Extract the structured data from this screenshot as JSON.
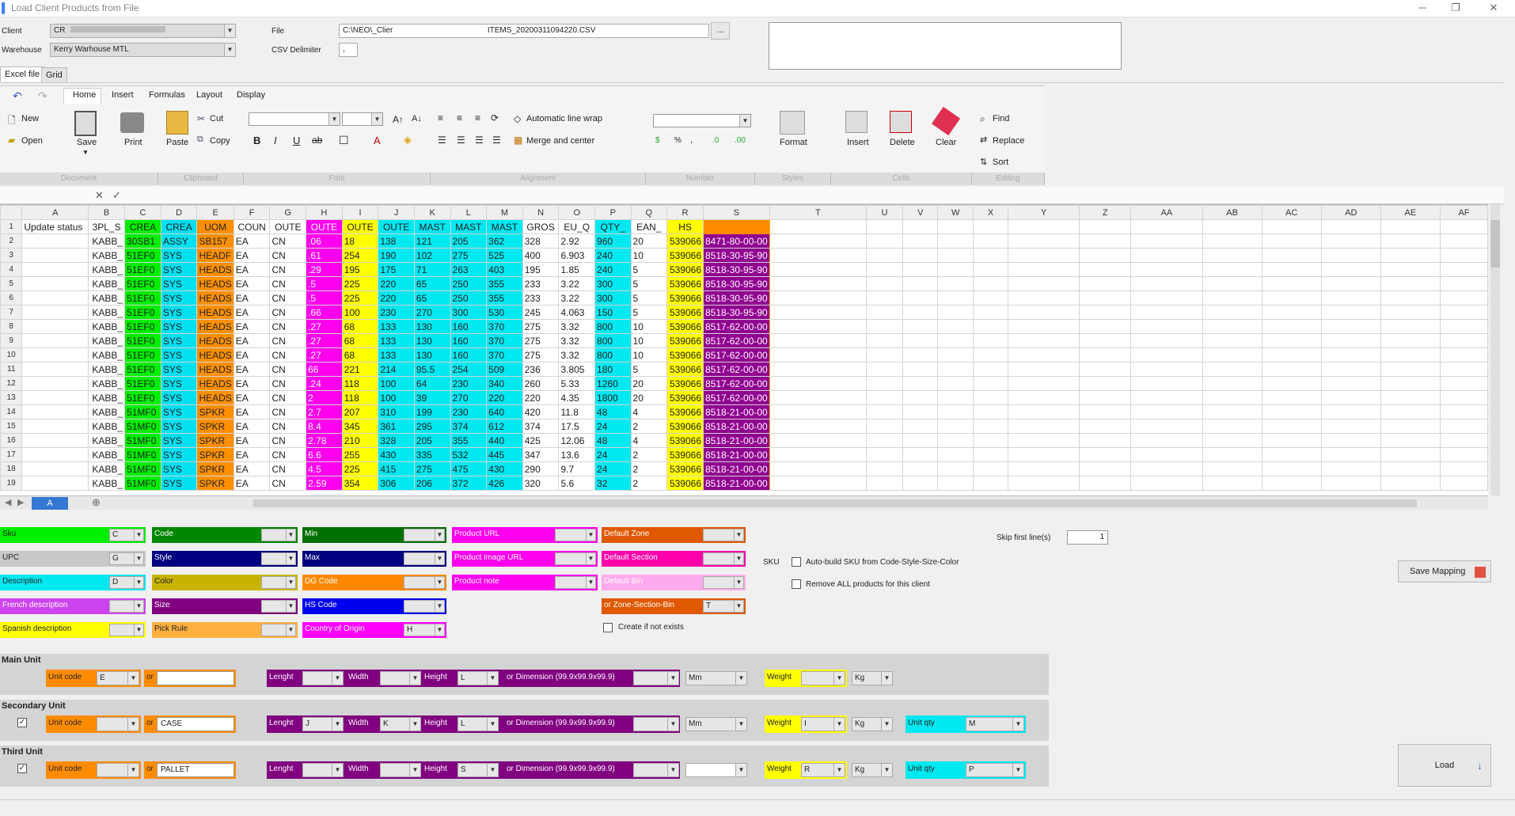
{
  "window": {
    "title": "Load Client Products from File"
  },
  "form": {
    "client_label": "Client",
    "client_value": "CR",
    "warehouse_label": "Warehouse",
    "warehouse_value": "Kerry Warhouse MTL",
    "file_label": "File",
    "file_value": "C:\\NEO\\_Clier                                           ITEMS_20200311094220.CSV",
    "browse_label": "...",
    "csv_delim_label": "CSV Delimiter",
    "csv_delim_value": ","
  },
  "tabs": {
    "excel": "Excel file",
    "grid": "Grid"
  },
  "ribbon": {
    "tabs": [
      "Home",
      "Insert",
      "Formulas",
      "Layout",
      "Display"
    ],
    "new": "New",
    "open": "Open",
    "save": "Save",
    "print": "Print",
    "paste": "Paste",
    "cut": "Cut",
    "copy": "Copy",
    "wrap": "Automatic line wrap",
    "merge": "Merge and center",
    "format": "Format",
    "insert": "Insert",
    "delete": "Delete",
    "clear": "Clear",
    "find": "Find",
    "replace": "Replace",
    "sort": "Sort",
    "groups": [
      "Document",
      "Clipboard",
      "Font",
      "Alignment",
      "Number",
      "Styles",
      "Cells",
      "Editing"
    ]
  },
  "sheet": {
    "columns": [
      "A",
      "B",
      "C",
      "D",
      "E",
      "F",
      "G",
      "H",
      "I",
      "J",
      "K",
      "L",
      "M",
      "N",
      "O",
      "P",
      "Q",
      "R",
      "S",
      "T",
      "U",
      "V",
      "W",
      "X",
      "Y",
      "Z",
      "AA",
      "AB",
      "AC",
      "AD",
      "AE",
      "AF"
    ],
    "header_row": [
      "Update status",
      "3PL_S",
      "CREA",
      "CREA",
      "UOM",
      "COUN",
      "OUTE",
      "OUTE",
      "OUTE",
      "OUTE",
      "MAST",
      "MAST",
      "MAST",
      "GROS",
      "EU_Q",
      "QTY_",
      "EAN_",
      "HS",
      ""
    ],
    "rows": [
      [
        "",
        "KABB_",
        "30SB1",
        "ASSY",
        "SB157",
        "EA",
        "CN",
        ".06",
        "18",
        "138",
        "121",
        "205",
        "362",
        "328",
        "2.92",
        "960",
        "20",
        "539066",
        "8471-80-00-00"
      ],
      [
        "",
        "KABB_",
        "51EF0",
        "SYS",
        "HEADF",
        "EA",
        "CN",
        ".61",
        "254",
        "190",
        "102",
        "275",
        "525",
        "400",
        "6.903",
        "240",
        "10",
        "539066",
        "8518-30-95-90"
      ],
      [
        "",
        "KABB_",
        "51EF0",
        "SYS",
        "HEADS",
        "EA",
        "CN",
        ".29",
        "195",
        "175",
        "71",
        "263",
        "403",
        "195",
        "1.85",
        "240",
        "5",
        "539066",
        "8518-30-95-90"
      ],
      [
        "",
        "KABB_",
        "51EF0",
        "SYS",
        "HEADS",
        "EA",
        "CN",
        ".5",
        "225",
        "220",
        "65",
        "250",
        "355",
        "233",
        "3.22",
        "300",
        "5",
        "539066",
        "8518-30-95-90"
      ],
      [
        "",
        "KABB_",
        "51EF0",
        "SYS",
        "HEADS",
        "EA",
        "CN",
        ".5",
        "225",
        "220",
        "65",
        "250",
        "355",
        "233",
        "3.22",
        "300",
        "5",
        "539066",
        "8518-30-95-90"
      ],
      [
        "",
        "KABB_",
        "51EF0",
        "SYS",
        "HEADS",
        "EA",
        "CN",
        ".66",
        "100",
        "230",
        "270",
        "300",
        "530",
        "245",
        "4.063",
        "150",
        "5",
        "539066",
        "8518-30-95-90"
      ],
      [
        "",
        "KABB_",
        "51EF0",
        "SYS",
        "HEADS",
        "EA",
        "CN",
        ".27",
        "68",
        "133",
        "130",
        "160",
        "370",
        "275",
        "3.32",
        "800",
        "10",
        "539066",
        "8517-62-00-00"
      ],
      [
        "",
        "KABB_",
        "51EF0",
        "SYS",
        "HEADS",
        "EA",
        "CN",
        ".27",
        "68",
        "133",
        "130",
        "160",
        "370",
        "275",
        "3.32",
        "800",
        "10",
        "539066",
        "8517-62-00-00"
      ],
      [
        "",
        "KABB_",
        "51EF0",
        "SYS",
        "HEADS",
        "EA",
        "CN",
        ".27",
        "68",
        "133",
        "130",
        "160",
        "370",
        "275",
        "3.32",
        "800",
        "10",
        "539066",
        "8517-62-00-00"
      ],
      [
        "",
        "KABB_",
        "51EF0",
        "SYS",
        "HEADS",
        "EA",
        "CN",
        "66",
        "221",
        "214",
        "95.5",
        "254",
        "509",
        "236",
        "3.805",
        "180",
        "5",
        "539066",
        "8517-62-00-00"
      ],
      [
        "",
        "KABB_",
        "51EF0",
        "SYS",
        "HEADS",
        "EA",
        "CN",
        ".24",
        "118",
        "100",
        "64",
        "230",
        "340",
        "260",
        "5.33",
        "1260",
        "20",
        "539066",
        "8517-62-00-00"
      ],
      [
        "",
        "KABB_",
        "51EF0",
        "SYS",
        "HEADS",
        "EA",
        "CN",
        "2",
        "118",
        "100",
        "39",
        "270",
        "220",
        "220",
        "4.35",
        "1800",
        "20",
        "539066",
        "8517-62-00-00"
      ],
      [
        "",
        "KABB_",
        "51MF0",
        "SYS",
        "SPKR",
        "EA",
        "CN",
        "2.7",
        "207",
        "310",
        "199",
        "230",
        "640",
        "420",
        "11.8",
        "48",
        "4",
        "539066",
        "8518-21-00-00"
      ],
      [
        "",
        "KABB_",
        "51MF0",
        "SYS",
        "SPKR",
        "EA",
        "CN",
        "8.4",
        "345",
        "361",
        "295",
        "374",
        "612",
        "374",
        "17.5",
        "24",
        "2",
        "539066",
        "8518-21-00-00"
      ],
      [
        "",
        "KABB_",
        "51MF0",
        "SYS",
        "SPKR",
        "EA",
        "CN",
        "2.78",
        "210",
        "328",
        "205",
        "355",
        "440",
        "425",
        "12.06",
        "48",
        "4",
        "539066",
        "8518-21-00-00"
      ],
      [
        "",
        "KABB_",
        "51MF0",
        "SYS",
        "SPKR",
        "EA",
        "CN",
        "6.6",
        "255",
        "430",
        "335",
        "532",
        "445",
        "347",
        "13.6",
        "24",
        "2",
        "539066",
        "8518-21-00-00"
      ],
      [
        "",
        "KABB_",
        "51MF0",
        "SYS",
        "SPKR",
        "EA",
        "CN",
        "4.5",
        "225",
        "415",
        "275",
        "475",
        "430",
        "290",
        "9.7",
        "24",
        "2",
        "539066",
        "8518-21-00-00"
      ],
      [
        "",
        "KABB_",
        "51MF0",
        "SYS",
        "SPKR",
        "EA",
        "CN",
        "2.59",
        "354",
        "306",
        "206",
        "372",
        "426",
        "320",
        "5.6",
        "32",
        "2",
        "539066",
        "8518-21-00-00"
      ]
    ],
    "sheet_tab": "A"
  },
  "mapping": {
    "col1": [
      {
        "label": "Sku",
        "value": "C",
        "color": "#00ee00"
      },
      {
        "label": "UPC",
        "value": "G",
        "color": "#c8c8c8"
      },
      {
        "label": "Description",
        "value": "D",
        "color": "#00e8f0"
      },
      {
        "label": "French description",
        "value": "",
        "color": "#cc44ee"
      },
      {
        "label": "Spanish description",
        "value": "",
        "color": "#ffff00"
      }
    ],
    "col2": [
      {
        "label": "Code",
        "value": "",
        "color": "#008800"
      },
      {
        "label": "Style",
        "value": "",
        "color": "#000080"
      },
      {
        "label": "Color",
        "value": "",
        "color": "#c8b400"
      },
      {
        "label": "Size",
        "value": "",
        "color": "#800080"
      },
      {
        "label": "Pick Rule",
        "value": "",
        "color": "#ffb040"
      }
    ],
    "col3": [
      {
        "label": "Min",
        "value": "",
        "color": "#007000"
      },
      {
        "label": "Max",
        "value": "",
        "color": "#000080"
      },
      {
        "label": "DG Code",
        "value": "",
        "color": "#ff8800"
      },
      {
        "label": "HS Code",
        "value": "",
        "color": "#0000ee"
      },
      {
        "label": "Country of Origin",
        "value": "H",
        "color": "#ff00ff"
      }
    ],
    "col4": [
      {
        "label": "Product URL",
        "value": "",
        "color": "#ff00ee"
      },
      {
        "label": "Product image URL",
        "value": "",
        "color": "#ff00ee"
      },
      {
        "label": "Product note",
        "value": "",
        "color": "#ff00ee"
      }
    ],
    "col5": [
      {
        "label": "Default Zone",
        "value": "",
        "color": "#e05800"
      },
      {
        "label": "Default Section",
        "value": "",
        "color": "#ff00aa"
      },
      {
        "label": "Default Bin",
        "value": "",
        "color": "#ffaaee"
      },
      {
        "label": "or Zone-Section-Bin",
        "value": "T",
        "color": "#e05800"
      }
    ],
    "create_if_not_exists": "Create if not exists",
    "skip_label": "Skip first line(s)",
    "skip_value": "1",
    "sku_label": "SKU",
    "auto_build": "Auto-build SKU from Code-Style-Size-Color",
    "remove_all": "Remove ALL products for this client",
    "save_mapping": "Save Mapping",
    "load": "Load"
  },
  "units": [
    {
      "title": "Main Unit",
      "checked": false,
      "unit_code": "E",
      "or_value": "",
      "lenght": "",
      "width": "",
      "height": "L",
      "dim": "",
      "dim_unit": "Mm",
      "weight": "",
      "weight_unit": "Kg",
      "has_qty": false,
      "qty": ""
    },
    {
      "title": "Secondary Unit",
      "checked": true,
      "unit_code": "",
      "or_value": "CASE",
      "lenght": "J",
      "width": "K",
      "height": "L",
      "dim": "",
      "dim_unit": "Mm",
      "weight": "I",
      "weight_unit": "Kg",
      "has_qty": true,
      "qty": "M"
    },
    {
      "title": "Third Unit",
      "checked": true,
      "unit_code": "",
      "or_value": "PALLET",
      "lenght": "",
      "width": "",
      "height": "S",
      "dim": "",
      "dim_unit": "",
      "weight": "R",
      "weight_unit": "Kg",
      "has_qty": true,
      "qty": "P"
    }
  ],
  "unit_labels": {
    "unit_code": "Unit code",
    "or": "or",
    "lenght": "Lenght",
    "width": "Width",
    "height": "Height",
    "dim": "or Dimension (99.9x99.9x99.9)",
    "weight": "Weight",
    "unit_qty": "Unit qty"
  }
}
